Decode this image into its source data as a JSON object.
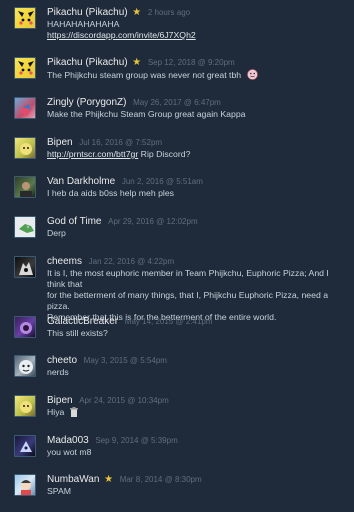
{
  "comments": [
    {
      "author": "Pikachu (Pikachu)",
      "starred": true,
      "timestamp": "2 hours ago",
      "lines": [
        "HAHAHAHAHAHA"
      ],
      "link": "https://discordapp.com/invite/6J7XQh2",
      "avatar_icon": "pikachu-avatar"
    },
    {
      "author": "Pikachu (Pikachu)",
      "starred": true,
      "timestamp": "Sep 12, 2018 @ 9:20pm",
      "lines": [
        "The Phijkchu steam group was never not great tbh"
      ],
      "emote_icon": "pink-face-emoticon",
      "avatar_icon": "pikachu-avatar"
    },
    {
      "author": "Zingly (PorygonZ)",
      "timestamp": "May 26, 2017 @ 6:47pm",
      "lines": [
        "Make the Phijkchu Steam Group great again Kappa"
      ],
      "avatar_icon": "porygon-avatar"
    },
    {
      "author": "Bipen",
      "timestamp": "Jul 16, 2016 @ 7:52pm",
      "link": "http://prntscr.com/btt7gr",
      "link_suffix": " Rip Discord?",
      "avatar_icon": "bipen-avatar"
    },
    {
      "author": "Van Darkholme",
      "timestamp": "Jun 2, 2016 @ 5:51am",
      "lines": [
        "I heb da aids b0ss help meh ples"
      ],
      "avatar_icon": "van-darkholme-avatar"
    },
    {
      "author": "God of Time",
      "timestamp": "Apr 29, 2016 @ 12:02pm",
      "lines": [
        "Derp"
      ],
      "avatar_icon": "god-of-time-avatar"
    },
    {
      "author": "cheems",
      "timestamp": "Jan 22, 2016 @ 4:22pm",
      "lines": [
        "It is I, the most euphoric member in Team Phijkchu, Euphoric Pizza; And I think that",
        "for the betterment of many things, that I, Phijkchu Euphoric Pizza, need a pizza.",
        "Remember that this is for the betterment of the entire world."
      ],
      "avatar_icon": "cheems-avatar"
    },
    {
      "author": "GalacticBreaker",
      "timestamp": "May 14, 2015 @ 2:41pm",
      "lines": [
        "This still exists?"
      ],
      "avatar_icon": "galactic-avatar"
    },
    {
      "author": "cheeto",
      "timestamp": "May 3, 2015 @ 5:54pm",
      "lines": [
        "nerds"
      ],
      "avatar_icon": "cheeto-avatar"
    },
    {
      "author": "Bipen",
      "timestamp": "Apr 24, 2015 @ 10:34pm",
      "lines": [
        "Hiya"
      ],
      "emote_icon": "trash-can-emoticon",
      "avatar_icon": "bipen-avatar"
    },
    {
      "author": "Mada003",
      "timestamp": "Sep 9, 2014 @ 5:39pm",
      "lines": [
        "you wot m8"
      ],
      "avatar_icon": "mada-avatar"
    },
    {
      "author": "NumbaWan",
      "starred": true,
      "timestamp": "Mar 8, 2014 @ 8:30pm",
      "lines": [
        "SPAM"
      ],
      "avatar_icon": "numbawan-avatar"
    }
  ],
  "icons": {
    "star": "★",
    "star_color": "#e8c238"
  },
  "colors": {
    "background": "#1f2a3a",
    "author": "#ebebeb",
    "timestamp": "#5e6f7e",
    "text": "#c9d3db"
  }
}
